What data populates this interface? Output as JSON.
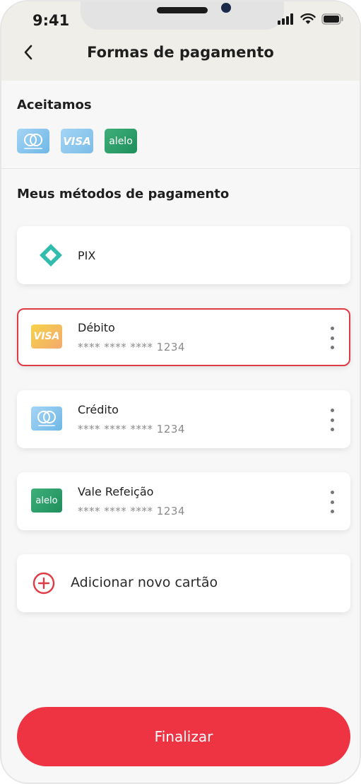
{
  "status_bar": {
    "time": "9:41"
  },
  "header": {
    "title": "Formas de pagamento"
  },
  "accepted": {
    "title": "Aceitamos",
    "brands": [
      {
        "icon": "mastercard-logo-icon"
      },
      {
        "icon": "visa-logo-icon",
        "text": "VISA"
      },
      {
        "icon": "alelo-logo-icon",
        "text": "alelo"
      }
    ]
  },
  "methods": {
    "title": "Meus métodos de pagamento",
    "pix": {
      "label": "PIX"
    },
    "cards": [
      {
        "name": "Débito",
        "number": "**** **** **** 1234",
        "brand_text": "VISA",
        "selected": true
      },
      {
        "name": "Crédito",
        "number": "**** **** **** 1234"
      },
      {
        "name": "Vale Refeição",
        "number": "**** **** **** 1234",
        "brand_text": "alelo"
      }
    ],
    "add_card": {
      "label": "Adicionar novo cartão"
    }
  },
  "footer": {
    "finalize_label": "Finalizar"
  },
  "colors": {
    "accent": "#ee3443",
    "selected_border": "#e03a45",
    "pix": "#32bcad"
  }
}
